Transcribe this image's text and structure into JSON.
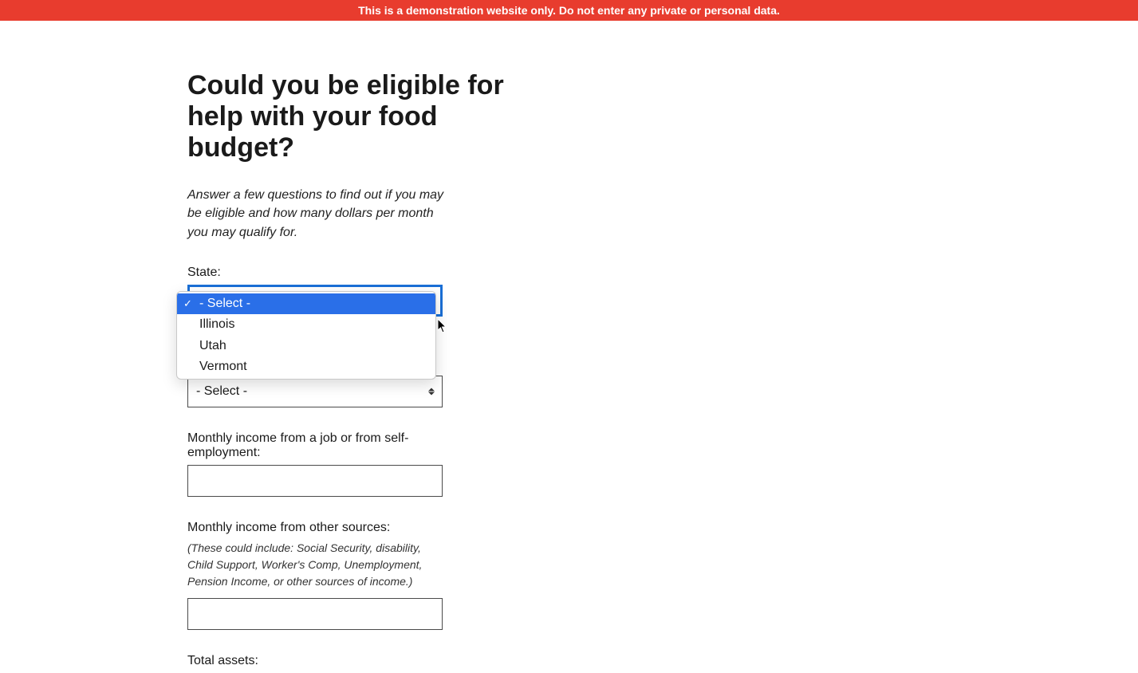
{
  "banner": {
    "text": "This is a demonstration website only. Do not enter any private or personal data."
  },
  "page": {
    "title": "Could you be eligible for help with your food budget?",
    "intro": "Answer a few questions to find out if you may be eligible and how many dollars per month you may qualify for."
  },
  "state_field": {
    "label": "State:",
    "selected": "- Select -",
    "dropdown": {
      "options": [
        {
          "label": "- Select -",
          "selected": true
        },
        {
          "label": "Illinois",
          "selected": false
        },
        {
          "label": "Utah",
          "selected": false
        },
        {
          "label": "Vermont",
          "selected": false
        }
      ]
    }
  },
  "second_select": {
    "selected": "- Select -"
  },
  "job_income": {
    "label": "Monthly income from a job or from self-employment:",
    "value": ""
  },
  "other_income": {
    "label": "Monthly income from other sources:",
    "hint": "(These could include: Social Security, disability, Child Support, Worker's Comp, Unemployment, Pension Income, or other sources of income.)",
    "value": ""
  },
  "total_assets": {
    "label": "Total assets:"
  }
}
